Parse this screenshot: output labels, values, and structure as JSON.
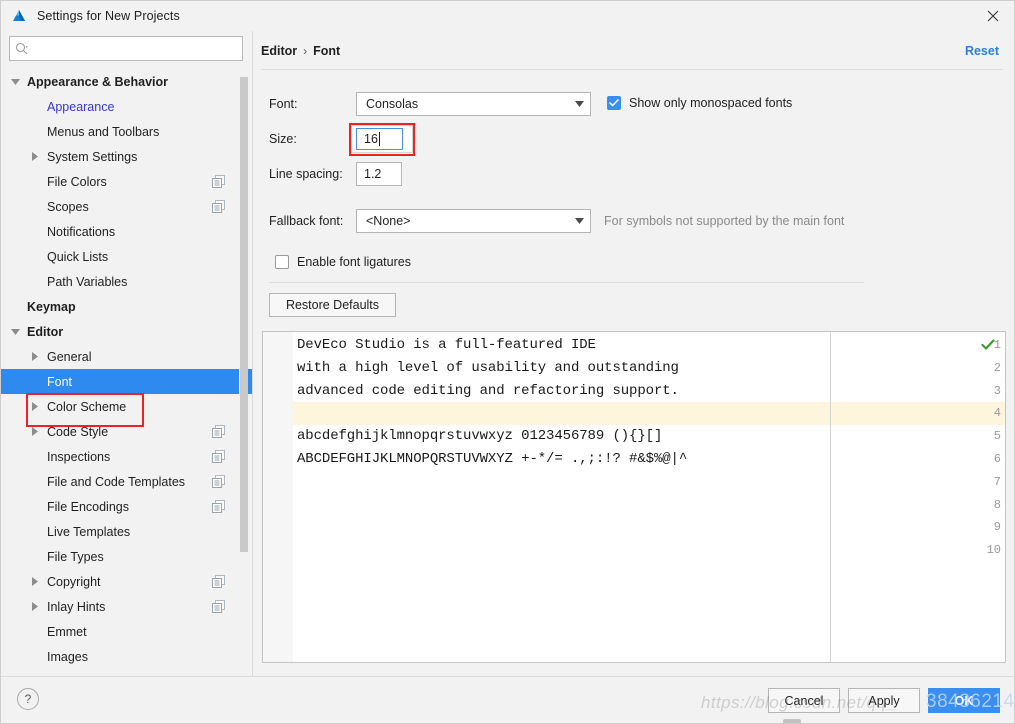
{
  "window": {
    "title": "Settings for New Projects",
    "logo_icon": "deveco-triangle-logo",
    "close_icon": "close-icon"
  },
  "search": {
    "value": "",
    "placeholder": "",
    "icon": "search-icon"
  },
  "sidebar": {
    "items": [
      {
        "label": "Appearance & Behavior",
        "indent": 0,
        "bold": true,
        "arrow": "down",
        "copy": false,
        "selected": false,
        "link": false
      },
      {
        "label": "Appearance",
        "indent": 1,
        "bold": false,
        "arrow": "none",
        "copy": false,
        "selected": false,
        "link": true
      },
      {
        "label": "Menus and Toolbars",
        "indent": 1,
        "bold": false,
        "arrow": "none",
        "copy": false,
        "selected": false,
        "link": false
      },
      {
        "label": "System Settings",
        "indent": 1,
        "bold": false,
        "arrow": "right",
        "copy": false,
        "selected": false,
        "link": false
      },
      {
        "label": "File Colors",
        "indent": 1,
        "bold": false,
        "arrow": "none",
        "copy": true,
        "selected": false,
        "link": false
      },
      {
        "label": "Scopes",
        "indent": 1,
        "bold": false,
        "arrow": "none",
        "copy": true,
        "selected": false,
        "link": false
      },
      {
        "label": "Notifications",
        "indent": 1,
        "bold": false,
        "arrow": "none",
        "copy": false,
        "selected": false,
        "link": false
      },
      {
        "label": "Quick Lists",
        "indent": 1,
        "bold": false,
        "arrow": "none",
        "copy": false,
        "selected": false,
        "link": false
      },
      {
        "label": "Path Variables",
        "indent": 1,
        "bold": false,
        "arrow": "none",
        "copy": false,
        "selected": false,
        "link": false
      },
      {
        "label": "Keymap",
        "indent": 0,
        "bold": true,
        "arrow": "none",
        "copy": false,
        "selected": false,
        "link": false
      },
      {
        "label": "Editor",
        "indent": 0,
        "bold": true,
        "arrow": "down",
        "copy": false,
        "selected": false,
        "link": false
      },
      {
        "label": "General",
        "indent": 1,
        "bold": false,
        "arrow": "right",
        "copy": false,
        "selected": false,
        "link": false
      },
      {
        "label": "Font",
        "indent": 1,
        "bold": false,
        "arrow": "none",
        "copy": false,
        "selected": true,
        "link": false
      },
      {
        "label": "Color Scheme",
        "indent": 1,
        "bold": false,
        "arrow": "right",
        "copy": false,
        "selected": false,
        "link": false
      },
      {
        "label": "Code Style",
        "indent": 1,
        "bold": false,
        "arrow": "right",
        "copy": true,
        "selected": false,
        "link": false
      },
      {
        "label": "Inspections",
        "indent": 1,
        "bold": false,
        "arrow": "none",
        "copy": true,
        "selected": false,
        "link": false
      },
      {
        "label": "File and Code Templates",
        "indent": 1,
        "bold": false,
        "arrow": "none",
        "copy": true,
        "selected": false,
        "link": false
      },
      {
        "label": "File Encodings",
        "indent": 1,
        "bold": false,
        "arrow": "none",
        "copy": true,
        "selected": false,
        "link": false
      },
      {
        "label": "Live Templates",
        "indent": 1,
        "bold": false,
        "arrow": "none",
        "copy": false,
        "selected": false,
        "link": false
      },
      {
        "label": "File Types",
        "indent": 1,
        "bold": false,
        "arrow": "none",
        "copy": false,
        "selected": false,
        "link": false
      },
      {
        "label": "Copyright",
        "indent": 1,
        "bold": false,
        "arrow": "right",
        "copy": true,
        "selected": false,
        "link": false
      },
      {
        "label": "Inlay Hints",
        "indent": 1,
        "bold": false,
        "arrow": "right",
        "copy": true,
        "selected": false,
        "link": false
      },
      {
        "label": "Emmet",
        "indent": 1,
        "bold": false,
        "arrow": "none",
        "copy": false,
        "selected": false,
        "link": false
      },
      {
        "label": "Images",
        "indent": 1,
        "bold": false,
        "arrow": "none",
        "copy": false,
        "selected": false,
        "link": false
      }
    ]
  },
  "breadcrumb": {
    "parent": "Editor",
    "separator": "›",
    "current": "Font"
  },
  "reset_link": "Reset",
  "form": {
    "font_label": "Font:",
    "font_value": "Consolas",
    "size_label": "Size:",
    "size_value": "16",
    "line_spacing_label": "Line spacing:",
    "line_spacing_value": "1.2",
    "fallback_label": "Fallback font:",
    "fallback_value": "<None>",
    "fallback_hint": "For symbols not supported by the main font",
    "monospaced_label": "Show only monospaced fonts",
    "monospaced_checked": true,
    "ligatures_label": "Enable font ligatures",
    "ligatures_checked": false,
    "restore_defaults_label": "Restore Defaults",
    "dropdown_icon": "chevron-down-icon",
    "checkmark_icon": "check-icon"
  },
  "preview": {
    "status_icon": "green-check-icon",
    "line_numbers": [
      "1",
      "2",
      "3",
      "4",
      "5",
      "6",
      "7",
      "8",
      "9",
      "10"
    ],
    "lines": [
      "DevEco Studio is a full-featured IDE",
      "with a high level of usability and outstanding",
      "advanced code editing and refactoring support.",
      "",
      "abcdefghijklmnopqrstuvwxyz 0123456789 (){}[]",
      "ABCDEFGHIJKLMNOPQRSTUVWXYZ +-*/= .,;:!? #&$%@|^",
      "",
      "",
      "",
      ""
    ],
    "highlighted_line": 4
  },
  "footer": {
    "help_label": "?",
    "cancel_label": "Cancel",
    "apply_label": "Apply",
    "ok_label": "OK"
  },
  "watermark": {
    "url_text": "https://blog.csdn.net/qq_",
    "id_text": "38436214"
  },
  "colors": {
    "accent": "#3a8ef0",
    "selection": "#2e8aee",
    "link": "#3b36d0",
    "reset_link": "#2e7ee0",
    "highlight_row": "#fdf6dd",
    "annotation_red": "#ee2222"
  }
}
